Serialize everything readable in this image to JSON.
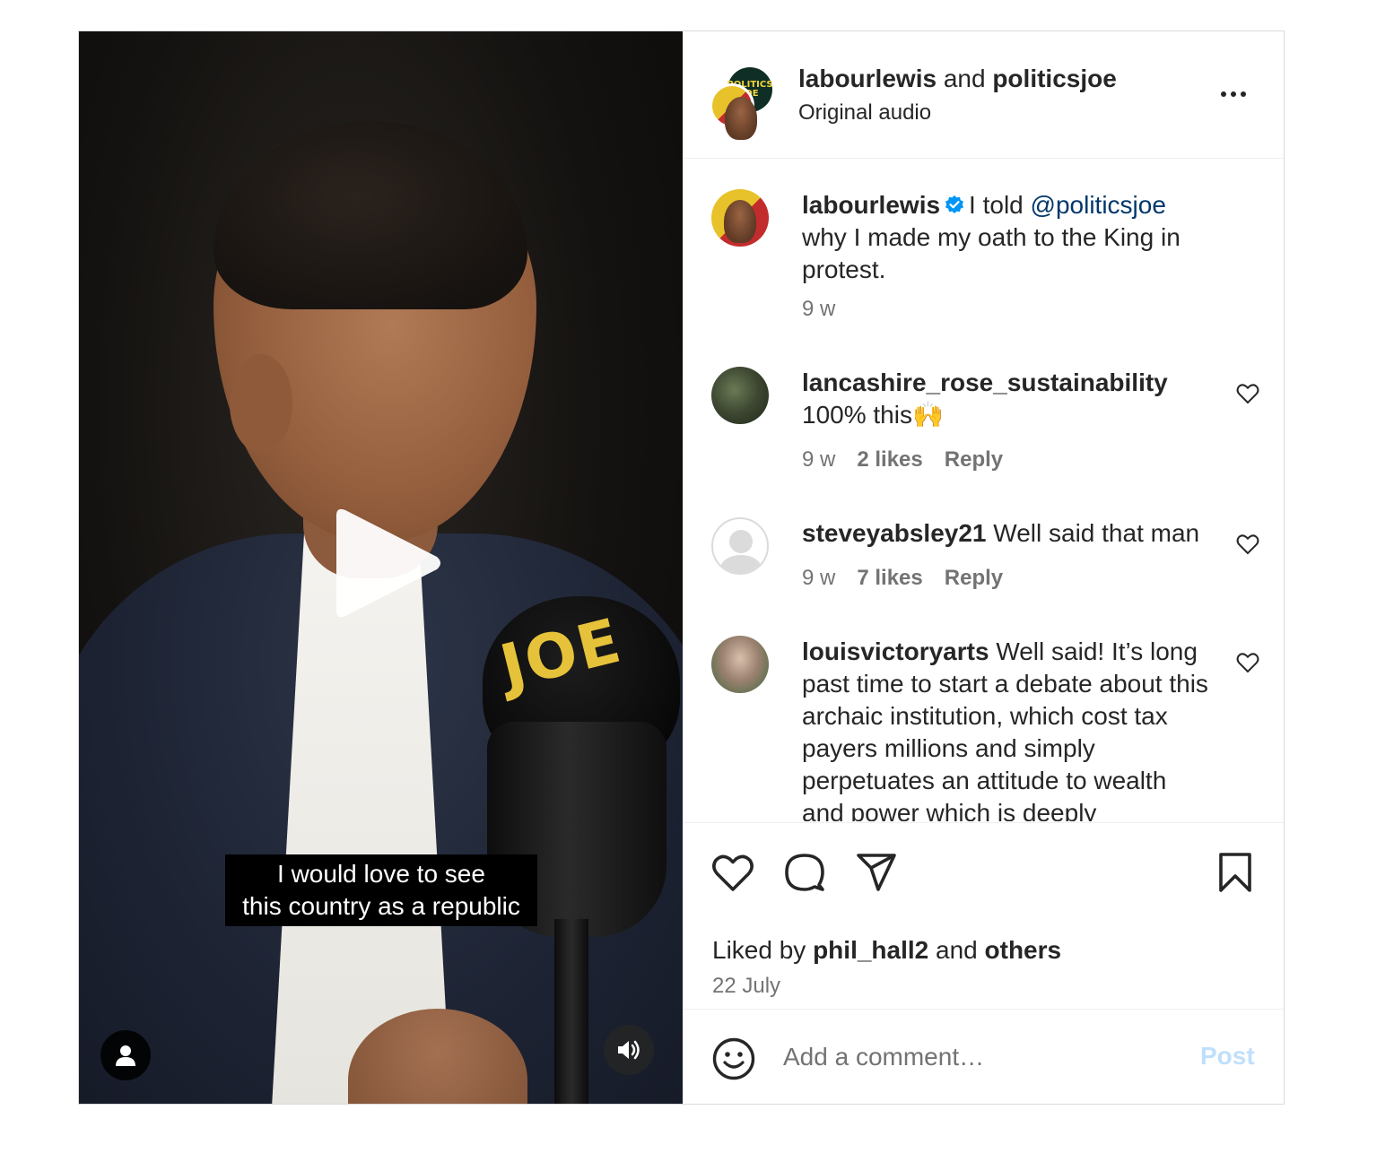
{
  "video": {
    "caption": "I would love to see\nthis country as a republic",
    "mic_brand": "JOE",
    "play_icon": "play-icon",
    "user_tag_icon": "person-icon",
    "audio_icon": "speaker-icon"
  },
  "header": {
    "user1": "labourlewis",
    "connector": "and",
    "user2": "politicsjoe",
    "audio": "Original audio",
    "avatar_back_text": "POLITICS JOE"
  },
  "caption_post": {
    "username": "labourlewis",
    "text_before": "I told ",
    "mention": "@politicsjoe",
    "text_after": " why I made my oath to the King in protest.",
    "time": "9 w"
  },
  "comments": [
    {
      "username": "lancashire_rose_sustainability",
      "text": "100% this🙌",
      "time": "9 w",
      "likes": "2 likes",
      "reply": "Reply"
    },
    {
      "username": "steveyabsley21",
      "text": "Well said that man",
      "time": "9 w",
      "likes": "7 likes",
      "reply": "Reply"
    },
    {
      "username": "louisvictoryarts",
      "text": "Well said! It’s long past time to start a debate about this archaic institution, which cost tax payers millions and simply perpetuates an attitude to wealth and power which is deeply"
    }
  ],
  "actions": {
    "liked_prefix": "Liked by ",
    "liked_user": "phil_hall2",
    "liked_and": " and ",
    "liked_others": "others",
    "date": "22 July"
  },
  "add_comment": {
    "placeholder": "Add a comment…",
    "post_label": "Post"
  },
  "colors": {
    "link": "#00376b",
    "verified": "#0095f6",
    "muted": "#737373",
    "post_disabled": "#c0dffd"
  }
}
